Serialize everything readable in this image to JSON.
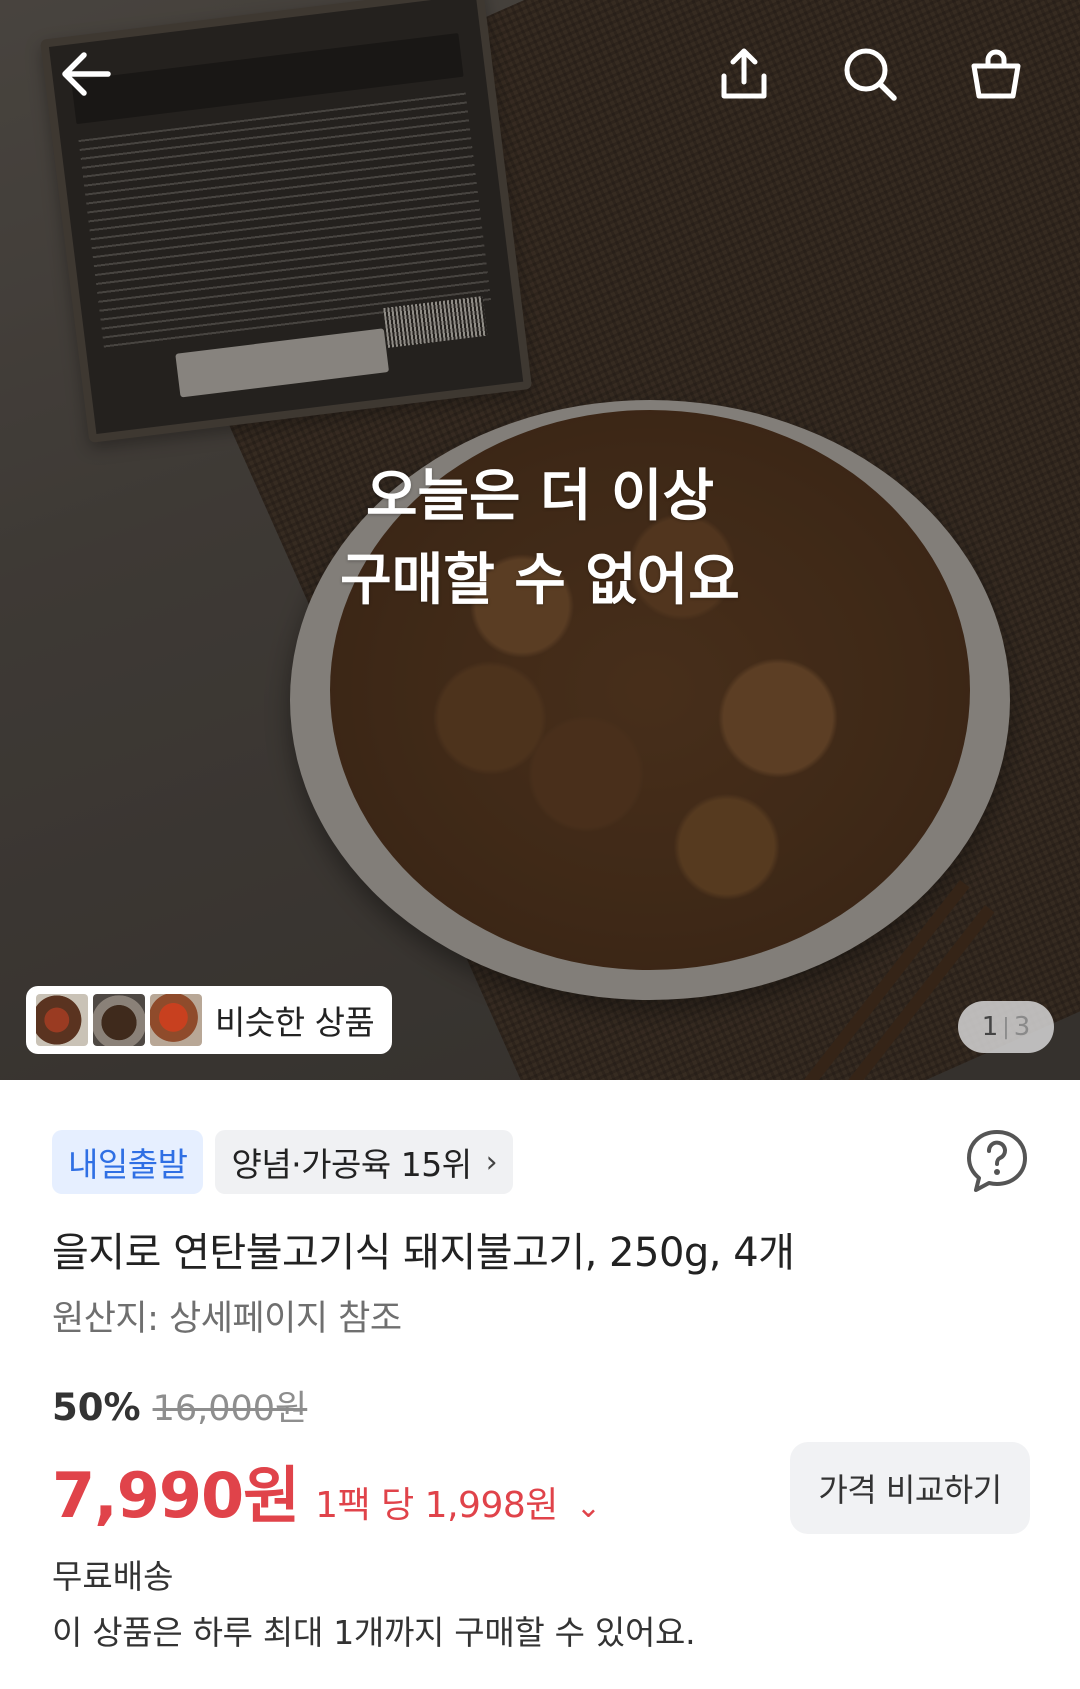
{
  "hero": {
    "overlay_lines": [
      "오늘은 더 이상",
      "구매할 수 없어요"
    ],
    "similar_label": "비슷한 상품",
    "counter": {
      "current": "1",
      "separator": "|",
      "total": "3"
    }
  },
  "header_icons": [
    "back-arrow-icon",
    "share-icon",
    "search-icon",
    "cart-icon"
  ],
  "badges": {
    "delivery": "내일출발",
    "rank": "양념·가공육 15위",
    "rank_chevron": "›"
  },
  "product": {
    "title": "을지로 연탄불고기식 돼지불고기, 250g, 4개",
    "origin": "원산지: 상세페이지 참조"
  },
  "pricing": {
    "discount": "50%",
    "original_price": "16,000원",
    "price": "7,990원",
    "unit_price": "1팩 당 1,998원",
    "unit_chevron": "⌄",
    "compare_button": "가격 비교하기"
  },
  "shipping": "무료배송",
  "purchase_limit": "이 상품은 하루 최대 1개까지 구매할 수 있어요.",
  "colors": {
    "accent_price": "#e0434a",
    "delivery_badge_bg": "#e6efff",
    "delivery_badge_text": "#2f6fe4"
  }
}
